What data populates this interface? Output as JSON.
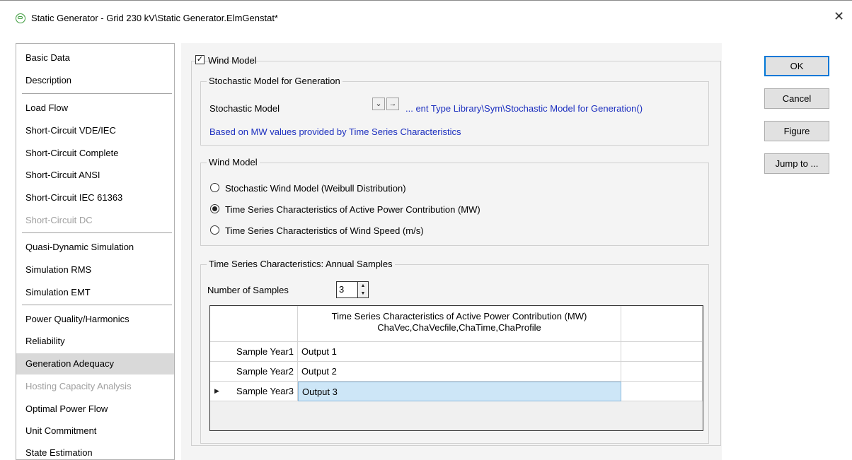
{
  "window": {
    "title": "Static Generator - Grid 230 kV\\Static Generator.ElmGenstat*",
    "close_symbol": "✕"
  },
  "sidebar": {
    "items": [
      {
        "label": "Basic Data",
        "state": "normal"
      },
      {
        "label": "Description",
        "state": "normal"
      },
      {
        "label": "Load Flow",
        "state": "normal"
      },
      {
        "label": "Short-Circuit VDE/IEC",
        "state": "normal"
      },
      {
        "label": "Short-Circuit Complete",
        "state": "normal"
      },
      {
        "label": "Short-Circuit ANSI",
        "state": "normal"
      },
      {
        "label": "Short-Circuit IEC 61363",
        "state": "normal"
      },
      {
        "label": "Short-Circuit DC",
        "state": "disabled"
      },
      {
        "label": "Quasi-Dynamic Simulation",
        "state": "normal"
      },
      {
        "label": "Simulation RMS",
        "state": "normal"
      },
      {
        "label": "Simulation EMT",
        "state": "normal"
      },
      {
        "label": "Power Quality/Harmonics",
        "state": "normal"
      },
      {
        "label": "Reliability",
        "state": "normal"
      },
      {
        "label": "Generation Adequacy",
        "state": "selected"
      },
      {
        "label": "Hosting Capacity Analysis",
        "state": "disabled"
      },
      {
        "label": "Optimal Power Flow",
        "state": "normal"
      },
      {
        "label": "Unit Commitment",
        "state": "normal"
      },
      {
        "label": "State Estimation",
        "state": "normal"
      }
    ]
  },
  "wind_model_checkbox": {
    "label": "Wind Model",
    "checked": true,
    "check_mark": "✓"
  },
  "stochastic_group": {
    "title": "Stochastic Model for Generation",
    "field_label": "Stochastic Model",
    "dropdown_glyph": "⌄",
    "jump_glyph": "→",
    "path_value": "... ent Type Library\\Sym\\Stochastic Model for Generation()",
    "info_text": "Based on MW values provided by Time Series Characteristics"
  },
  "wind_model_group": {
    "title": "Wind Model",
    "options": [
      {
        "label": "Stochastic Wind Model (Weibull Distribution)",
        "selected": false
      },
      {
        "label": "Time Series Characteristics of Active Power Contribution (MW)",
        "selected": true
      },
      {
        "label": "Time Series Characteristics of Wind Speed (m/s)",
        "selected": false
      }
    ]
  },
  "annual_samples_group": {
    "title": "Time Series Characteristics: Annual Samples",
    "samples_label": "Number of Samples",
    "samples_value": "3",
    "spin_up": "▲",
    "spin_down": "▼",
    "table": {
      "header_line1": "Time Series Characteristics of Active Power Contribution (MW)",
      "header_line2": "ChaVec,ChaVecfile,ChaTime,ChaProfile",
      "current_row_marker": "▶",
      "rows": [
        {
          "label": "Sample Year1",
          "value": "Output 1"
        },
        {
          "label": "Sample Year2",
          "value": "Output 2"
        },
        {
          "label": "Sample Year3",
          "value": "Output 3"
        }
      ]
    }
  },
  "buttons": {
    "ok": "OK",
    "cancel": "Cancel",
    "figure": "Figure",
    "jump_to": "Jump to ..."
  },
  "colors": {
    "link_blue": "#1c2fbf",
    "selection_fill": "#cde6f7",
    "default_button_border": "#0078d7"
  }
}
